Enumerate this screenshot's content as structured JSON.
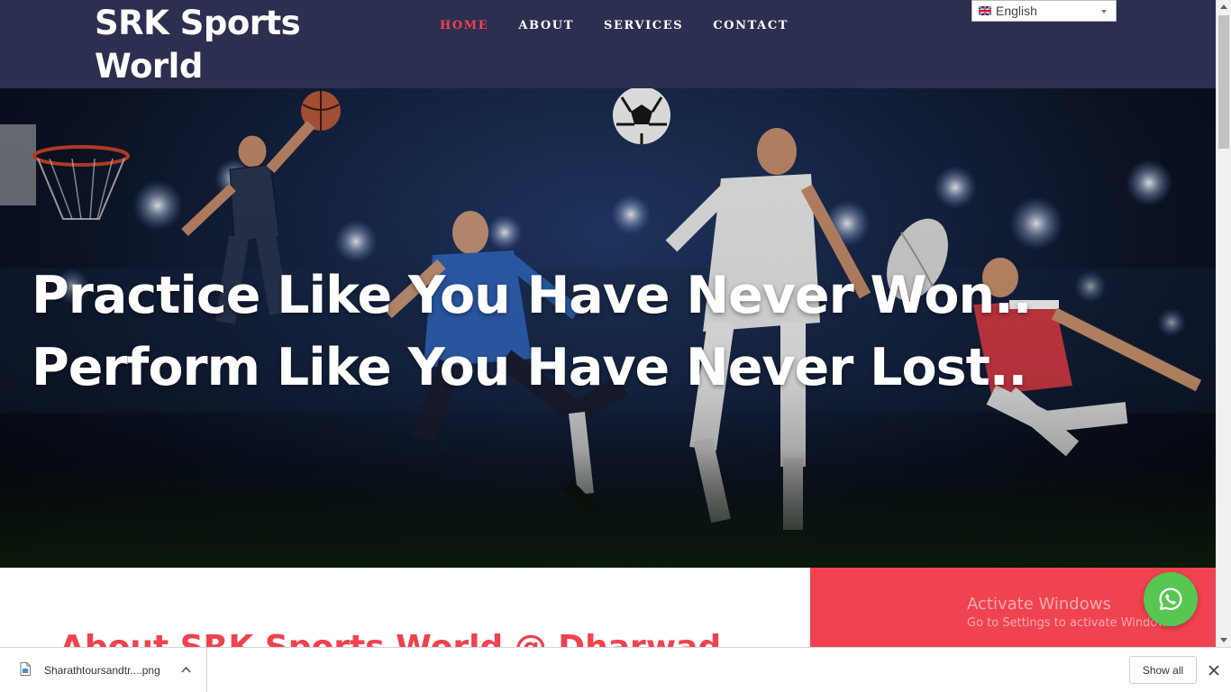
{
  "header": {
    "brand_line1": "SRK Sports",
    "brand_line2": "World",
    "nav": [
      {
        "label": "HOME",
        "active": true
      },
      {
        "label": "ABOUT",
        "active": false
      },
      {
        "label": "SERVICES",
        "active": false
      },
      {
        "label": "CONTACT",
        "active": false
      }
    ],
    "language": {
      "selected": "English",
      "icon": "uk-flag-icon"
    }
  },
  "hero": {
    "line1": "Practice Like You Have Never Won..",
    "line2": "Perform Like You Have Never Lost.."
  },
  "about": {
    "heading": "About SRK Sports World @ Dharwad"
  },
  "windows_notice": {
    "title": "Activate Windows",
    "subtitle": "Go to Settings to activate Windows."
  },
  "whatsapp": {
    "icon": "whatsapp-icon"
  },
  "download_bar": {
    "filename": "Sharathtoursandtr....png",
    "show_all": "Show all"
  },
  "colors": {
    "header_bg": "#2d2f50",
    "accent": "#f0424f",
    "whatsapp_green": "#57c751"
  }
}
